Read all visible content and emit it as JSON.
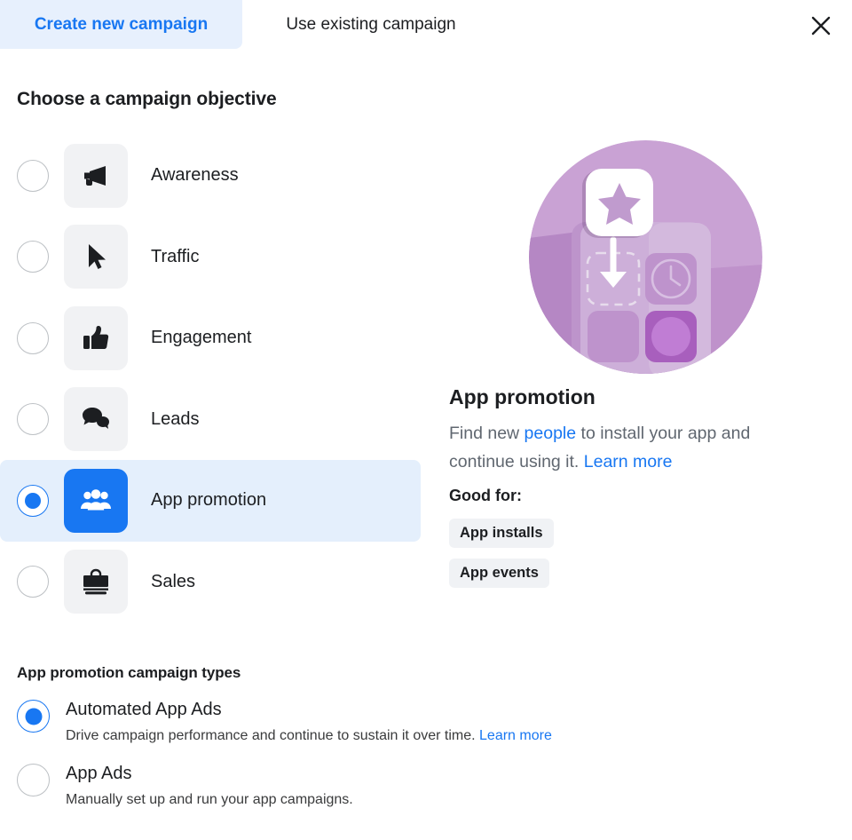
{
  "header": {
    "tabs": [
      {
        "label": "Create new campaign",
        "active": true
      },
      {
        "label": "Use existing campaign",
        "active": false
      }
    ],
    "close_icon": "close-icon"
  },
  "objective_section": {
    "title": "Choose a campaign objective",
    "items": [
      {
        "label": "Awareness",
        "icon": "megaphone-icon",
        "selected": false
      },
      {
        "label": "Traffic",
        "icon": "cursor-icon",
        "selected": false
      },
      {
        "label": "Engagement",
        "icon": "thumbs-up-icon",
        "selected": false
      },
      {
        "label": "Leads",
        "icon": "chat-bubbles-icon",
        "selected": false
      },
      {
        "label": "App promotion",
        "icon": "people-group-icon",
        "selected": true
      },
      {
        "label": "Sales",
        "icon": "shopping-bag-icon",
        "selected": false
      }
    ]
  },
  "detail": {
    "illustration": "app-promotion-illustration",
    "title": "App promotion",
    "description_part1": "Find new ",
    "description_link1": "people",
    "description_part2": " to install your app and continue using it. ",
    "description_link2": "Learn more",
    "good_for_label": "Good for:",
    "badges": [
      "App installs",
      "App events"
    ]
  },
  "campaign_types": {
    "title": "App promotion campaign types",
    "options": [
      {
        "name": "Automated App Ads",
        "description": "Drive campaign performance and continue to sustain it over time. ",
        "link": "Learn more",
        "selected": true
      },
      {
        "name": "App Ads",
        "description": "Manually set up and run your app campaigns.",
        "link": "",
        "selected": false
      }
    ]
  },
  "colors": {
    "accent": "#1877F2",
    "tab_active_bg": "#E7F0FD",
    "row_selected_bg": "#E4EFFC",
    "tile_bg": "#F1F2F4",
    "badge_bg": "#F0F2F5",
    "text_primary": "#1c1e21",
    "text_secondary": "#606770",
    "illustration_purple": "#B98FC4"
  }
}
